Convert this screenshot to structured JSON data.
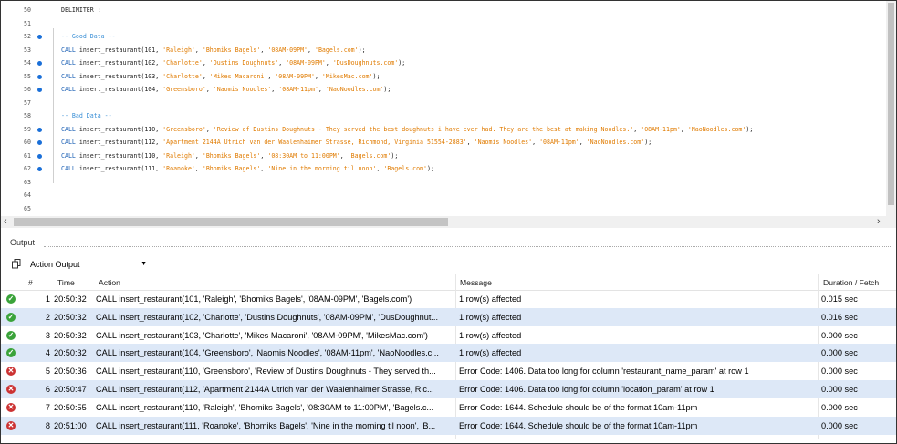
{
  "editor": {
    "lines": [
      {
        "num": "50",
        "dot": false,
        "parts": [
          {
            "t": "DELIMITER ;",
            "c": ""
          }
        ]
      },
      {
        "num": "51",
        "dot": false,
        "parts": []
      },
      {
        "num": "52",
        "dot": true,
        "parts": [
          {
            "t": "-- Good Data --",
            "c": "cm"
          }
        ]
      },
      {
        "num": "53",
        "dot": false,
        "parts": [
          {
            "t": "CALL ",
            "c": "kw"
          },
          {
            "t": "insert_restaurant(101, ",
            "c": ""
          },
          {
            "t": "'Raleigh'",
            "c": "str"
          },
          {
            "t": ", ",
            "c": ""
          },
          {
            "t": "'Bhomiks Bagels'",
            "c": "str"
          },
          {
            "t": ", ",
            "c": ""
          },
          {
            "t": "'08AM-09PM'",
            "c": "str"
          },
          {
            "t": ", ",
            "c": ""
          },
          {
            "t": "'Bagels.com'",
            "c": "str"
          },
          {
            "t": ");",
            "c": ""
          }
        ]
      },
      {
        "num": "54",
        "dot": true,
        "parts": [
          {
            "t": "CALL ",
            "c": "kw"
          },
          {
            "t": "insert_restaurant(102, ",
            "c": ""
          },
          {
            "t": "'Charlotte'",
            "c": "str"
          },
          {
            "t": ", ",
            "c": ""
          },
          {
            "t": "'Dustins Doughnuts'",
            "c": "str"
          },
          {
            "t": ", ",
            "c": ""
          },
          {
            "t": "'08AM-09PM'",
            "c": "str"
          },
          {
            "t": ", ",
            "c": ""
          },
          {
            "t": "'DusDoughnuts.com'",
            "c": "str"
          },
          {
            "t": ");",
            "c": ""
          }
        ]
      },
      {
        "num": "55",
        "dot": true,
        "parts": [
          {
            "t": "CALL ",
            "c": "kw"
          },
          {
            "t": "insert_restaurant(103, ",
            "c": ""
          },
          {
            "t": "'Charlotte'",
            "c": "str"
          },
          {
            "t": ", ",
            "c": ""
          },
          {
            "t": "'Mikes Macaroni'",
            "c": "str"
          },
          {
            "t": ", ",
            "c": ""
          },
          {
            "t": "'08AM-09PM'",
            "c": "str"
          },
          {
            "t": ", ",
            "c": ""
          },
          {
            "t": "'MikesMac.com'",
            "c": "str"
          },
          {
            "t": ");",
            "c": ""
          }
        ]
      },
      {
        "num": "56",
        "dot": true,
        "parts": [
          {
            "t": "CALL ",
            "c": "kw"
          },
          {
            "t": "insert_restaurant(104, ",
            "c": ""
          },
          {
            "t": "'Greensboro'",
            "c": "str"
          },
          {
            "t": ", ",
            "c": ""
          },
          {
            "t": "'Naomis Noodles'",
            "c": "str"
          },
          {
            "t": ", ",
            "c": ""
          },
          {
            "t": "'08AM-11pm'",
            "c": "str"
          },
          {
            "t": ", ",
            "c": ""
          },
          {
            "t": "'NaoNoodles.com'",
            "c": "str"
          },
          {
            "t": ");",
            "c": ""
          }
        ]
      },
      {
        "num": "57",
        "dot": false,
        "parts": []
      },
      {
        "num": "58",
        "dot": false,
        "parts": [
          {
            "t": "-- Bad Data --",
            "c": "cm"
          }
        ]
      },
      {
        "num": "59",
        "dot": true,
        "parts": [
          {
            "t": "CALL ",
            "c": "kw"
          },
          {
            "t": "insert_restaurant(110, ",
            "c": ""
          },
          {
            "t": "'Greensboro'",
            "c": "str"
          },
          {
            "t": ", ",
            "c": ""
          },
          {
            "t": "'Review of Dustins Doughnuts - They served the best doughnuts i have ever had. They are the best at making Noodles.'",
            "c": "str"
          },
          {
            "t": ", ",
            "c": ""
          },
          {
            "t": "'08AM-11pm'",
            "c": "str"
          },
          {
            "t": ", ",
            "c": ""
          },
          {
            "t": "'NaoNoodles.com'",
            "c": "str"
          },
          {
            "t": ");",
            "c": ""
          }
        ]
      },
      {
        "num": "60",
        "dot": true,
        "parts": [
          {
            "t": "CALL ",
            "c": "kw"
          },
          {
            "t": "insert_restaurant(112, ",
            "c": ""
          },
          {
            "t": "'Apartment 2144A Utrich van der Waalenhaimer Strasse, Richmond, Virginia 51554-2883'",
            "c": "str"
          },
          {
            "t": ", ",
            "c": ""
          },
          {
            "t": "'Naomis Noodles'",
            "c": "str"
          },
          {
            "t": ", ",
            "c": ""
          },
          {
            "t": "'08AM-11pm'",
            "c": "str"
          },
          {
            "t": ", ",
            "c": ""
          },
          {
            "t": "'NaoNoodles.com'",
            "c": "str"
          },
          {
            "t": ");",
            "c": ""
          }
        ]
      },
      {
        "num": "61",
        "dot": true,
        "parts": [
          {
            "t": "CALL ",
            "c": "kw"
          },
          {
            "t": "insert_restaurant(110, ",
            "c": ""
          },
          {
            "t": "'Raleigh'",
            "c": "str"
          },
          {
            "t": ", ",
            "c": ""
          },
          {
            "t": "'Bhomiks Bagels'",
            "c": "str"
          },
          {
            "t": ", ",
            "c": ""
          },
          {
            "t": "'08:30AM to 11:00PM'",
            "c": "str"
          },
          {
            "t": ", ",
            "c": ""
          },
          {
            "t": "'Bagels.com'",
            "c": "str"
          },
          {
            "t": ");",
            "c": ""
          }
        ]
      },
      {
        "num": "62",
        "dot": true,
        "parts": [
          {
            "t": "CALL ",
            "c": "kw"
          },
          {
            "t": "insert_restaurant(111, ",
            "c": ""
          },
          {
            "t": "'Roanoke'",
            "c": "str"
          },
          {
            "t": ", ",
            "c": ""
          },
          {
            "t": "'Bhomiks Bagels'",
            "c": "str"
          },
          {
            "t": ", ",
            "c": ""
          },
          {
            "t": "'Nine in the morning til noon'",
            "c": "str"
          },
          {
            "t": ", ",
            "c": ""
          },
          {
            "t": "'Bagels.com'",
            "c": "str"
          },
          {
            "t": ");",
            "c": ""
          }
        ]
      },
      {
        "num": "63",
        "dot": false,
        "parts": []
      },
      {
        "num": "64",
        "dot": false,
        "parts": []
      },
      {
        "num": "65",
        "dot": false,
        "parts": []
      }
    ]
  },
  "output": {
    "title": "Output",
    "selector": "Action Output",
    "columns": [
      "#",
      "Time",
      "Action",
      "Message",
      "Duration / Fetch"
    ],
    "rows": [
      {
        "status": "ok",
        "num": "1",
        "time": "20:50:32",
        "action": "CALL insert_restaurant(101, 'Raleigh', 'Bhomiks Bagels', '08AM-09PM', 'Bagels.com')",
        "message": "1 row(s) affected",
        "duration": "0.015 sec"
      },
      {
        "status": "ok",
        "num": "2",
        "time": "20:50:32",
        "action": "CALL insert_restaurant(102, 'Charlotte', 'Dustins Doughnuts', '08AM-09PM', 'DusDoughnut...",
        "message": "1 row(s) affected",
        "duration": "0.016 sec"
      },
      {
        "status": "ok",
        "num": "3",
        "time": "20:50:32",
        "action": "CALL insert_restaurant(103, 'Charlotte', 'Mikes Macaroni', '08AM-09PM', 'MikesMac.com')",
        "message": "1 row(s) affected",
        "duration": "0.000 sec"
      },
      {
        "status": "ok",
        "num": "4",
        "time": "20:50:32",
        "action": "CALL insert_restaurant(104, 'Greensboro', 'Naomis Noodles', '08AM-11pm', 'NaoNoodles.c...",
        "message": "1 row(s) affected",
        "duration": "0.000 sec"
      },
      {
        "status": "err",
        "num": "5",
        "time": "20:50:36",
        "action": "CALL insert_restaurant(110, 'Greensboro', 'Review of Dustins Doughnuts - They served th...",
        "message": "Error Code: 1406. Data too long for column 'restaurant_name_param' at row 1",
        "duration": "0.000 sec"
      },
      {
        "status": "err",
        "num": "6",
        "time": "20:50:47",
        "action": "CALL insert_restaurant(112, 'Apartment 2144A Utrich van der Waalenhaimer Strasse, Ric...",
        "message": "Error Code: 1406. Data too long for column 'location_param' at row 1",
        "duration": "0.000 sec"
      },
      {
        "status": "err",
        "num": "7",
        "time": "20:50:55",
        "action": "CALL insert_restaurant(110, 'Raleigh', 'Bhomiks Bagels', '08:30AM to 11:00PM', 'Bagels.c...",
        "message": "Error Code: 1644. Schedule should be of the format 10am-11pm",
        "duration": "0.000 sec"
      },
      {
        "status": "err",
        "num": "8",
        "time": "20:51:00",
        "action": "CALL insert_restaurant(111, 'Roanoke', 'Bhomiks Bagels', 'Nine in the morning til noon', 'B...",
        "message": "Error Code: 1644. Schedule should be of the format 10am-11pm",
        "duration": "0.000 sec"
      }
    ]
  }
}
